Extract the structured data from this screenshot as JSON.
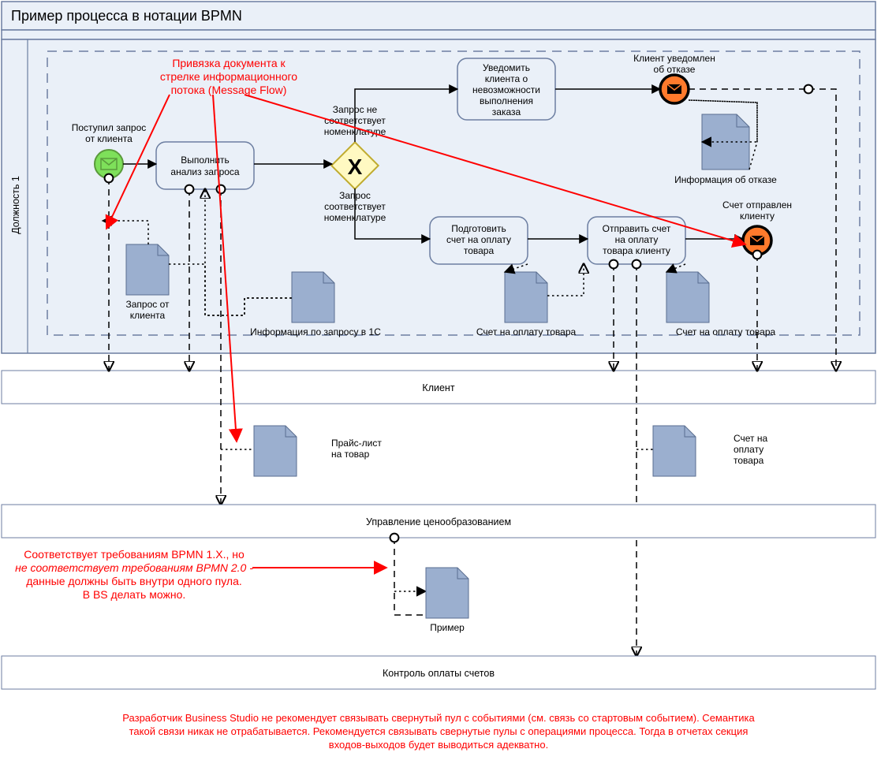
{
  "pool": {
    "title": "Пример процесса в нотации BPMN",
    "lane": "Должность 1"
  },
  "events": {
    "start": {
      "label1": "Поступил запрос",
      "label2": "от клиента"
    },
    "refused": {
      "label1": "Клиент уведомлен",
      "label2": "об отказе"
    },
    "sent": {
      "label1": "Счет отправлен",
      "label2": "клиенту"
    }
  },
  "tasks": {
    "analyze": {
      "l1": "Выполнить",
      "l2": "анализ запроса"
    },
    "notify": {
      "l1": "Уведомить",
      "l2": "клиента о",
      "l3": "невозможности",
      "l4": "выполнения",
      "l5": "заказа"
    },
    "prepare": {
      "l1": "Подготовить",
      "l2": "счет на оплату",
      "l3": "товара"
    },
    "send": {
      "l1": "Отправить счет",
      "l2": "на оплату",
      "l3": "товара клиенту"
    }
  },
  "gateway": {
    "top1": "Запрос не",
    "top2": "соответствует",
    "top3": "номенклатуре",
    "bot1": "Запрос",
    "bot2": "соответствует",
    "bot3": "номенклатуре"
  },
  "data": {
    "request": {
      "l1": "Запрос от",
      "l2": "клиента"
    },
    "info1c": {
      "l1": "Информация по запросу в 1С"
    },
    "invoice1": {
      "l1": "Счет на оплату товара"
    },
    "invoice2": {
      "l1": "Счет на оплату товара"
    },
    "refusal": {
      "l1": "Информация об отказе"
    },
    "pricelist": {
      "l1": "Прайс-лист",
      "l2": "на товар"
    },
    "invoiceExt": {
      "l1": "Счет на",
      "l2": "оплату",
      "l3": "товара"
    },
    "example": {
      "l1": "Пример"
    }
  },
  "pools": {
    "client": "Клиент",
    "pricing": "Управление ценообразованием",
    "control": "Контроль оплаты счетов"
  },
  "annotations": {
    "a1": {
      "l1": "Привязка документа к",
      "l2": "стрелке информационного",
      "l3": "потока (Message Flow)"
    },
    "a2": {
      "l1": "Соответствует требованиям BPMN 1.X., но",
      "l2": "не соответствует требованиям BPMN 2.0  -",
      "l3": "данные должны быть внутри одного пула.",
      "l4": "В BS делать можно."
    },
    "a3": {
      "l1": "Разработчик Business Studio не рекомендует связывать свернутый пул с событиями (см. связь со стартовым событием). Семантика",
      "l2": "такой связи никак не отрабатывается.  Рекомендуется связывать свернутые пулы с операциями процесса. Тогда в отчетах секция",
      "l3": "входов-выходов будет выводиться адекватно."
    }
  }
}
